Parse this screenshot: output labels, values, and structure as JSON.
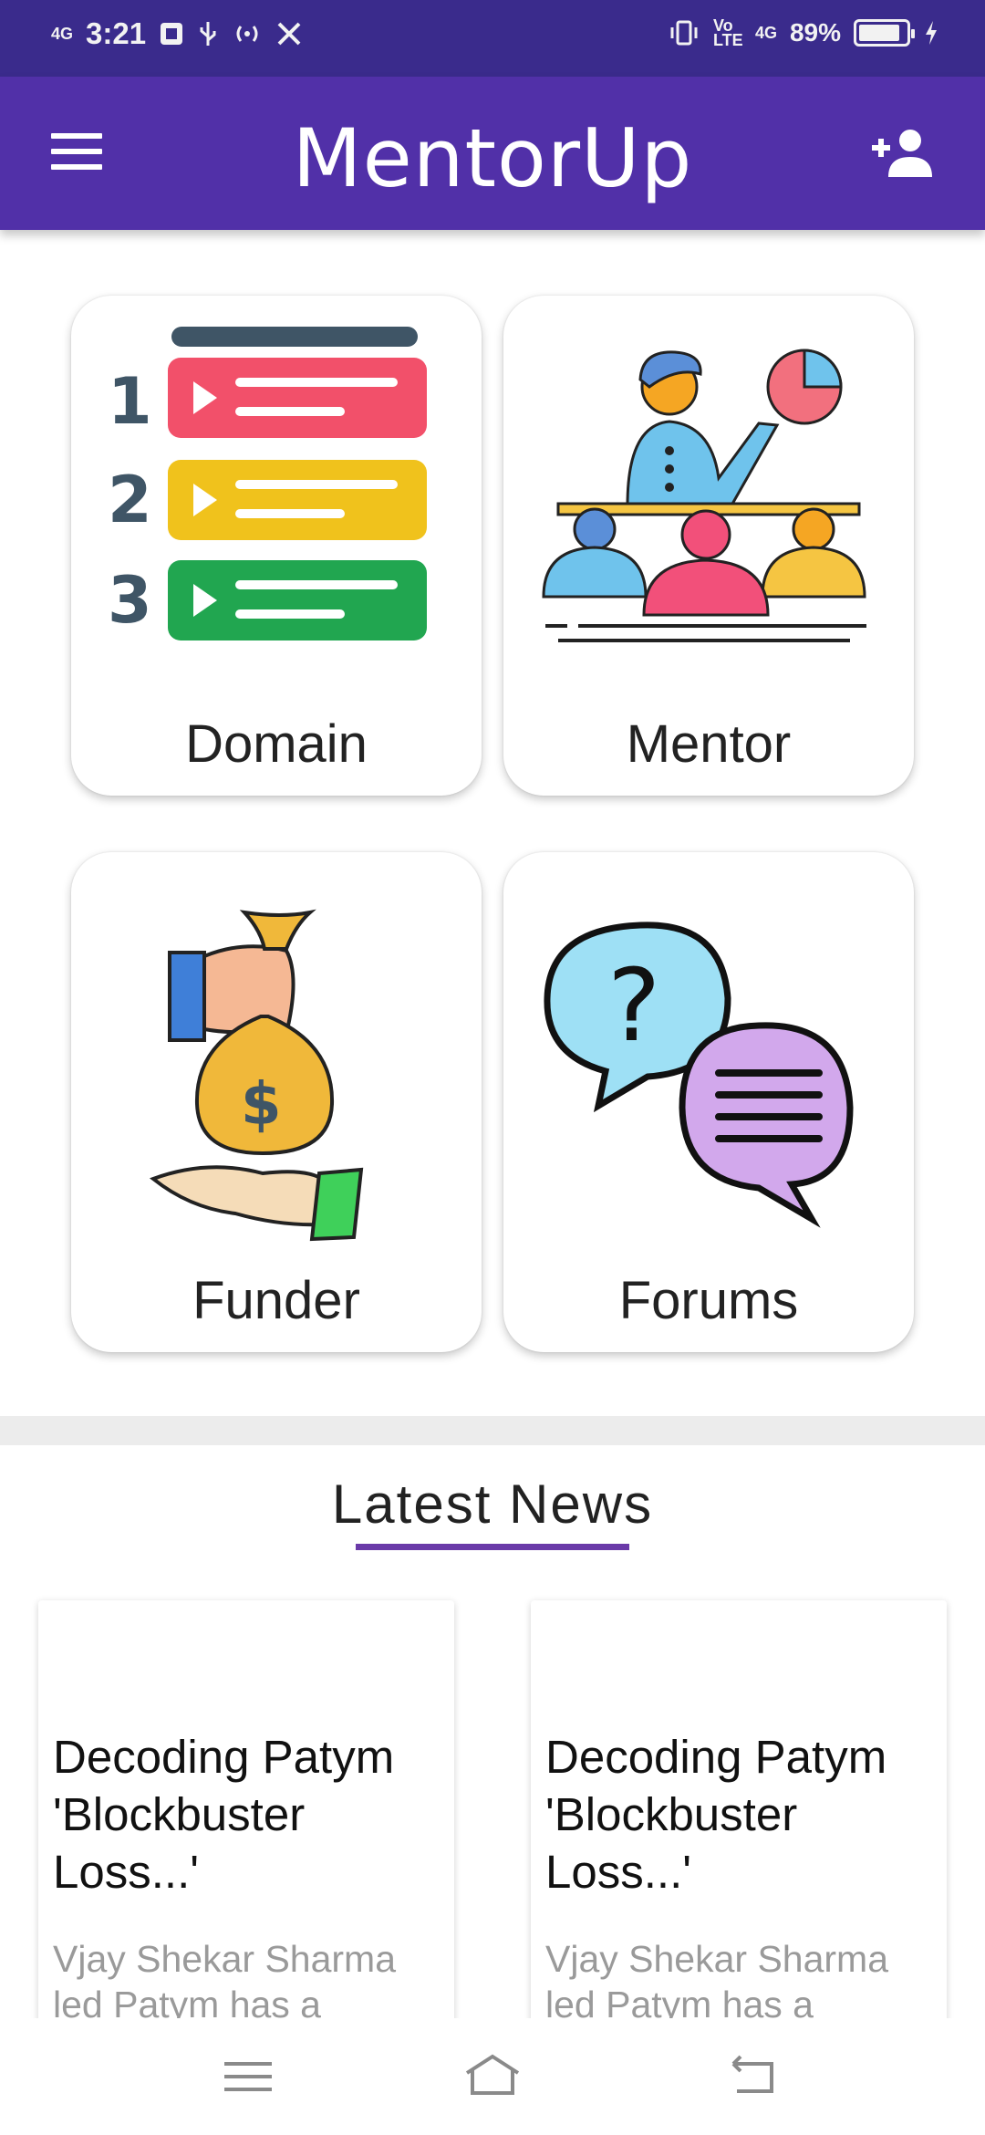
{
  "status_bar": {
    "network": "4G",
    "time": "3:21",
    "volte": "Vo LTE",
    "network2": "4G",
    "battery_percent": "89%",
    "battery_level": 0.89
  },
  "app_bar": {
    "title": "MentorUp",
    "menu_icon": "hamburger-menu-icon",
    "action_icon": "add-user-icon"
  },
  "cards": [
    {
      "label": "Domain",
      "icon": "numbered-list-icon"
    },
    {
      "label": "Mentor",
      "icon": "mentor-presentation-icon"
    },
    {
      "label": "Funder",
      "icon": "money-bag-icon"
    },
    {
      "label": "Forums",
      "icon": "chat-bubbles-icon"
    }
  ],
  "news": {
    "title": "Latest News",
    "items": [
      {
        "headline": "Decoding Patym 'Blockbuster Loss...'",
        "snippet": "Vjay Shekar Sharma led Patym has a"
      },
      {
        "headline": "Decoding Patym 'Blockbuster Loss...'",
        "snippet": "Vjay Shekar Sharma led Patym has a"
      }
    ]
  },
  "nav": {
    "recents_icon": "recents-icon",
    "home_icon": "home-icon",
    "back_icon": "back-icon"
  },
  "colors": {
    "status_bar": "#3a2b8c",
    "app_bar": "#5130a8",
    "accent": "#6a3aa8"
  }
}
